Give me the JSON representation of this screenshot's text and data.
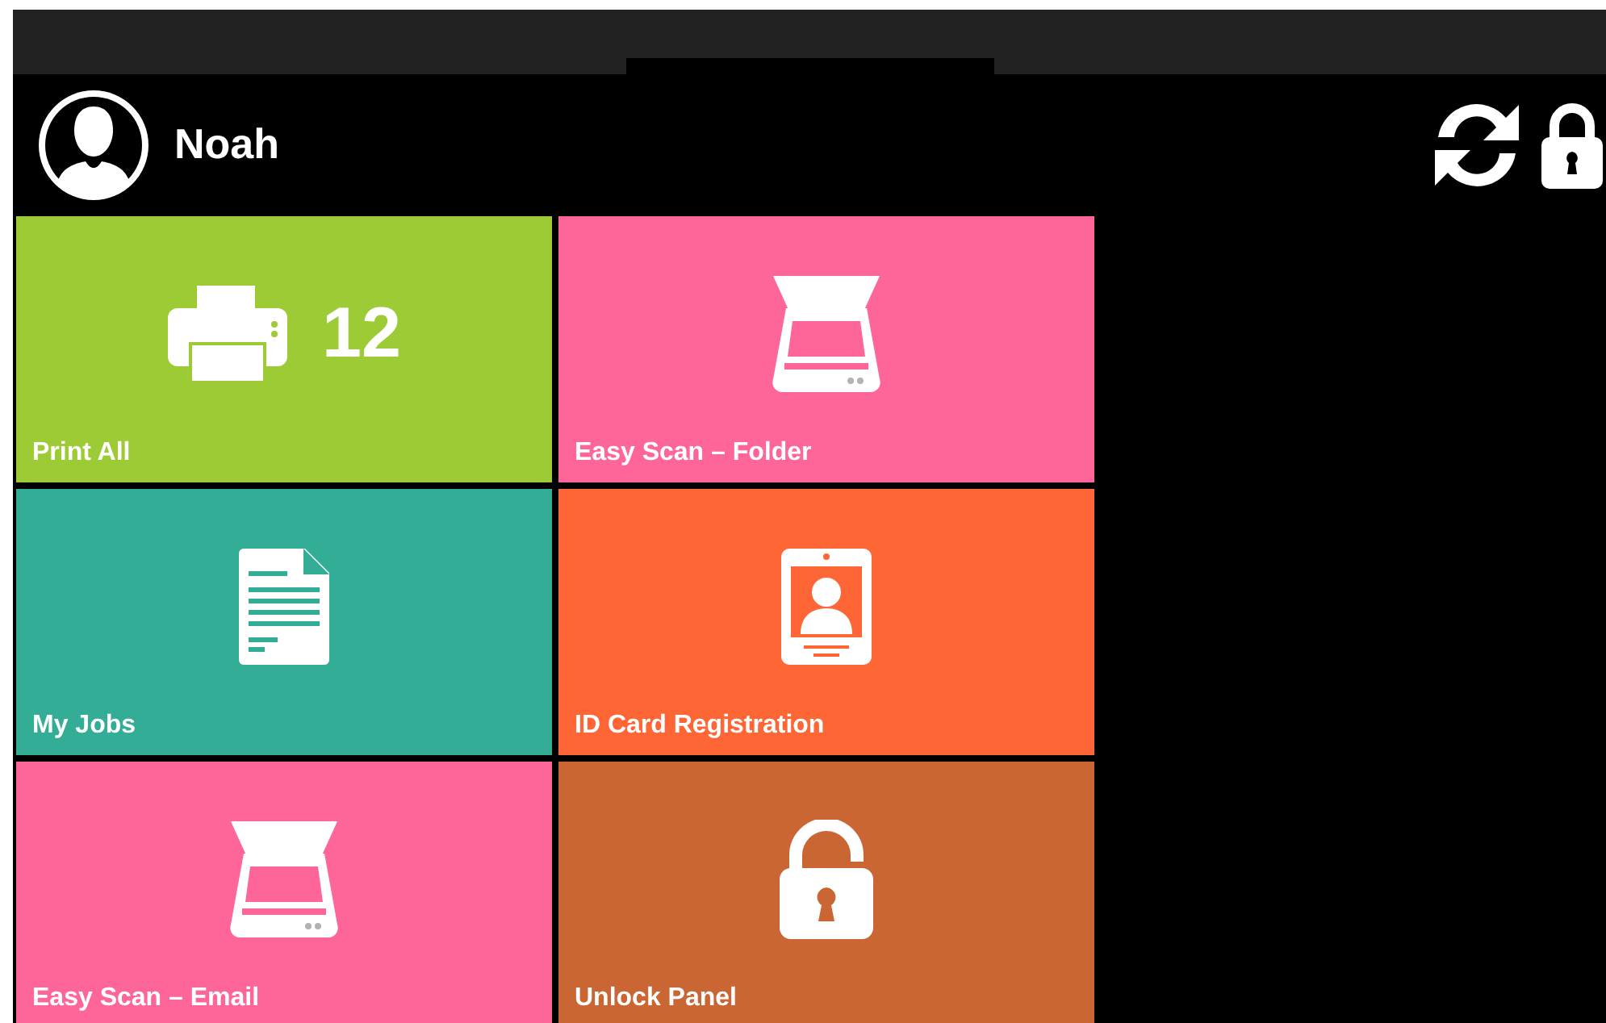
{
  "user": {
    "name": "Noah"
  },
  "tiles": [
    {
      "kind": "printer",
      "label": "Print All",
      "count": "12",
      "color": "#9ccb35"
    },
    {
      "kind": "scanner",
      "label": "Easy Scan – Folder",
      "color": "#fe6699"
    },
    {
      "kind": "document",
      "label": "My Jobs",
      "color": "#33ad95"
    },
    {
      "kind": "idcard",
      "label": "ID Card Registration",
      "color": "#fe6636"
    },
    {
      "kind": "scanner",
      "label": "Easy Scan – Email",
      "color": "#fe6699"
    },
    {
      "kind": "unlock",
      "label": "Unlock Panel",
      "color": "#c96633"
    }
  ]
}
